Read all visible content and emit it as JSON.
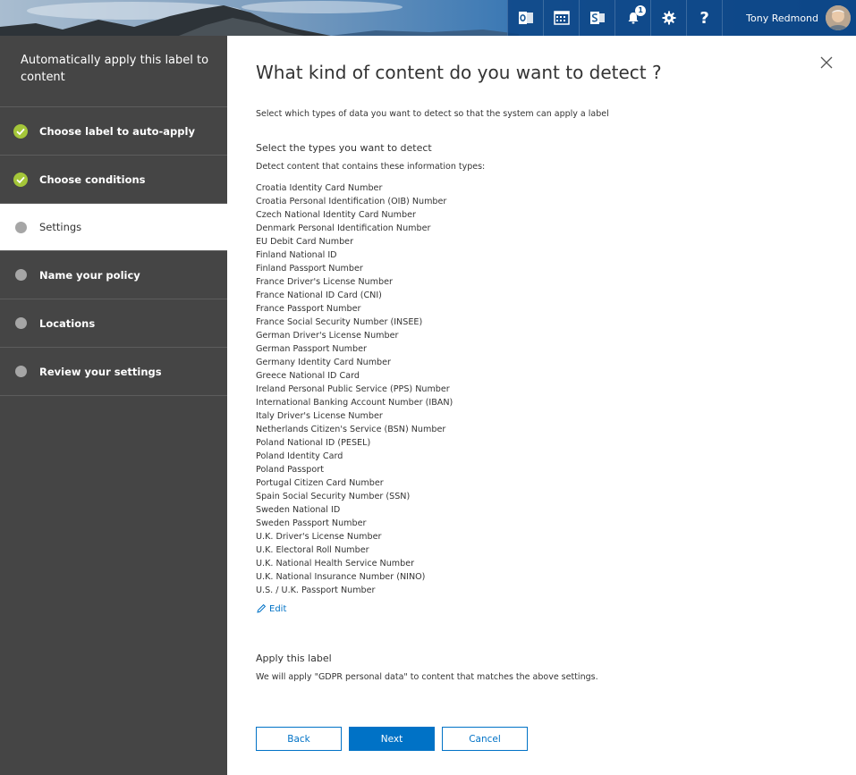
{
  "topbar": {
    "icons": [
      "outlook-icon",
      "calendar-icon",
      "sharepoint-icon",
      "bell-icon",
      "gear-icon",
      "help-icon"
    ],
    "notification_count": "1",
    "help_glyph": "?",
    "user_name": "Tony Redmond"
  },
  "wizard": {
    "title": "Automatically apply this label to content",
    "steps": [
      {
        "label": "Choose label to auto-apply",
        "state": "done"
      },
      {
        "label": "Choose conditions",
        "state": "done"
      },
      {
        "label": "Settings",
        "state": "current"
      },
      {
        "label": "Name your policy",
        "state": "pending"
      },
      {
        "label": "Locations",
        "state": "pending"
      },
      {
        "label": "Review your settings",
        "state": "pending"
      }
    ]
  },
  "main": {
    "heading": "What kind of content do you want to detect ?",
    "description": "Select which types of data you want to detect so that the system can apply a label",
    "types_heading": "Select the types you want to detect",
    "types_subheading": "Detect content that contains these information types:",
    "types": [
      "Croatia Identity Card Number",
      "Croatia Personal Identification (OIB) Number",
      "Czech National Identity Card Number",
      "Denmark Personal Identification Number",
      "EU Debit Card Number",
      "Finland National ID",
      "Finland Passport Number",
      "France Driver's License Number",
      "France National ID Card (CNI)",
      "France Passport Number",
      "France Social Security Number (INSEE)",
      "German Driver's License Number",
      "German Passport Number",
      "Germany Identity Card Number",
      "Greece National ID Card",
      "Ireland Personal Public Service (PPS) Number",
      "International Banking Account Number (IBAN)",
      "Italy Driver's License Number",
      "Netherlands Citizen's Service (BSN) Number",
      "Poland National ID (PESEL)",
      "Poland Identity Card",
      "Poland Passport",
      "Portugal Citizen Card Number",
      "Spain Social Security Number (SSN)",
      "Sweden National ID",
      "Sweden Passport Number",
      "U.K. Driver's License Number",
      "U.K. Electoral Roll Number",
      "U.K. National Health Service Number",
      "U.K. National Insurance Number (NINO)",
      "U.S. / U.K. Passport Number"
    ],
    "edit_label": "Edit",
    "apply_heading": "Apply this label",
    "apply_description": "We will apply \"GDPR personal data\" to content that matches the above settings."
  },
  "buttons": {
    "back": "Back",
    "next": "Next",
    "cancel": "Cancel"
  },
  "colors": {
    "accent": "#0072c6",
    "done_check": "#a4c639",
    "panel": "#454545"
  }
}
